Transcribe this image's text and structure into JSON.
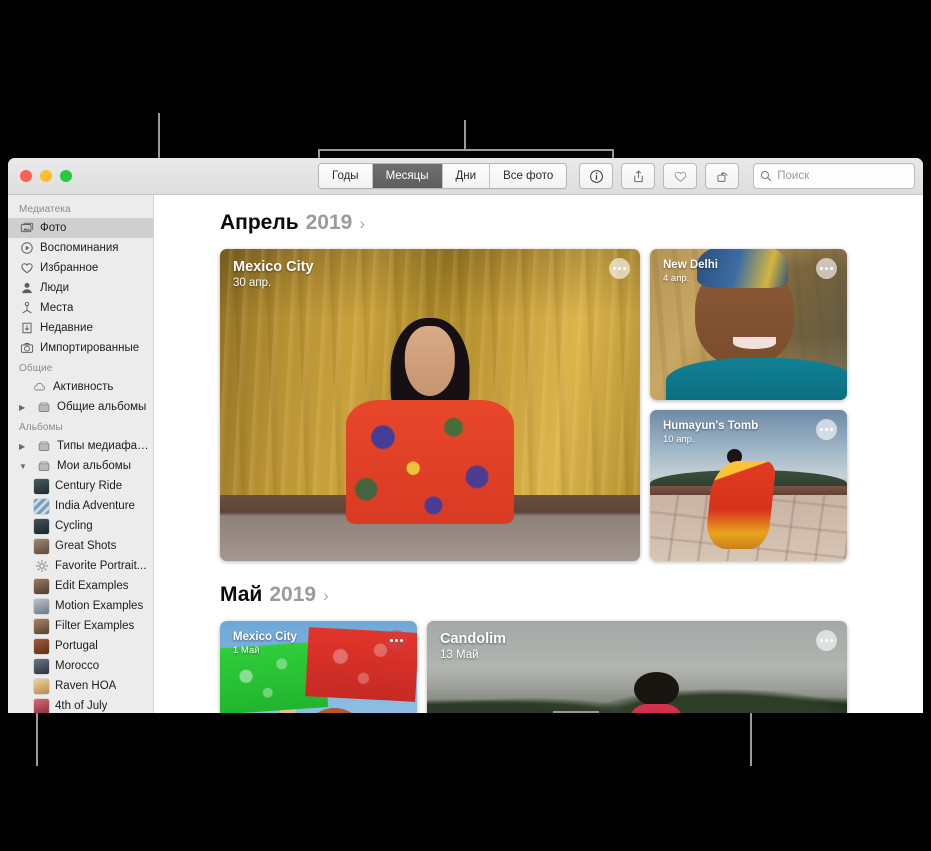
{
  "window": {
    "traffic_lights": [
      "close",
      "minimize",
      "zoom"
    ]
  },
  "toolbar": {
    "segments": [
      {
        "label": "Годы",
        "active": false
      },
      {
        "label": "Месяцы",
        "active": true
      },
      {
        "label": "Дни",
        "active": false
      },
      {
        "label": "Все фото",
        "active": false
      }
    ],
    "buttons": [
      {
        "name": "info-button",
        "icon": "info-icon"
      },
      {
        "name": "share-button",
        "icon": "share-icon"
      },
      {
        "name": "favorite-button",
        "icon": "heart-icon"
      },
      {
        "name": "rotate-button",
        "icon": "rotate-icon"
      }
    ],
    "search": {
      "placeholder": "Поиск",
      "value": ""
    }
  },
  "sidebar": {
    "sections": [
      {
        "header": "Медиатека",
        "items": [
          {
            "label": "Фото",
            "icon": "photos-icon",
            "selected": true
          },
          {
            "label": "Воспоминания",
            "icon": "memories-icon",
            "selected": false
          },
          {
            "label": "Избранное",
            "icon": "heart-icon",
            "selected": false
          },
          {
            "label": "Люди",
            "icon": "person-icon",
            "selected": false
          },
          {
            "label": "Места",
            "icon": "places-icon",
            "selected": false
          },
          {
            "label": "Недавние",
            "icon": "recents-icon",
            "selected": false
          },
          {
            "label": "Импортированные",
            "icon": "imported-icon",
            "selected": false
          }
        ]
      },
      {
        "header": "Общие",
        "items": [
          {
            "label": "Активность",
            "icon": "cloud-icon",
            "selected": false,
            "disclosure": ""
          },
          {
            "label": "Общие альбомы",
            "icon": "folder-icon",
            "selected": false,
            "disclosure": "collapsed"
          }
        ]
      },
      {
        "header": "Альбомы",
        "items": [
          {
            "label": "Типы медиафайлов",
            "icon": "folder-icon",
            "selected": false,
            "disclosure": "collapsed"
          },
          {
            "label": "Мои альбомы",
            "icon": "folder-icon",
            "selected": false,
            "disclosure": "expanded"
          }
        ]
      }
    ],
    "albums": [
      {
        "label": "Century Ride",
        "thumb": "#2f3a3f"
      },
      {
        "label": "India Adventure",
        "thumb": "#7fa7c9"
      },
      {
        "label": "Cycling",
        "thumb": "#2d3a42"
      },
      {
        "label": "Great Shots",
        "thumb": "#8e7a68"
      },
      {
        "label": "Favorite Portrait...",
        "thumb": "smart-album-icon"
      },
      {
        "label": "Edit Examples",
        "thumb": "#7c6250"
      },
      {
        "label": "Motion Examples",
        "thumb": "#9aa4b0"
      },
      {
        "label": "Filter Examples",
        "thumb": "#8a6f5c"
      },
      {
        "label": "Portugal",
        "thumb": "#7b4b34"
      },
      {
        "label": "Morocco",
        "thumb": "#4b5360"
      },
      {
        "label": "Raven HOA",
        "thumb": "#d8b77f"
      },
      {
        "label": "4th of July",
        "thumb": "#b4474f"
      }
    ]
  },
  "main": {
    "months": [
      {
        "name": "Апрель",
        "year": "2019",
        "chevron": "›",
        "cards": [
          {
            "title": "Mexico City",
            "date": "30 апр.",
            "scene": "sc-mexico",
            "size": "big"
          },
          {
            "title": "New Delhi",
            "date": "4 апр.",
            "scene": "sc-delhi",
            "size": "small"
          },
          {
            "title": "Humayun's Tomb",
            "date": "10 апр.",
            "scene": "sc-tomb",
            "size": "small"
          }
        ]
      },
      {
        "name": "Май",
        "year": "2019",
        "chevron": "›",
        "cards": [
          {
            "title": "Mexico City",
            "date": "1 Май",
            "scene": "sc-mexico2",
            "size": "small"
          },
          {
            "title": "Candolim",
            "date": "13 Май",
            "scene": "sc-candolim",
            "size": "big"
          }
        ]
      }
    ]
  },
  "colors": {
    "accent_selected_segment": "#5e5e5e",
    "sidebar_bg": "#ececec",
    "sidebar_selected": "#cfcfcf",
    "callout_line": "#9a9a9a",
    "page_bg": "#000000"
  }
}
